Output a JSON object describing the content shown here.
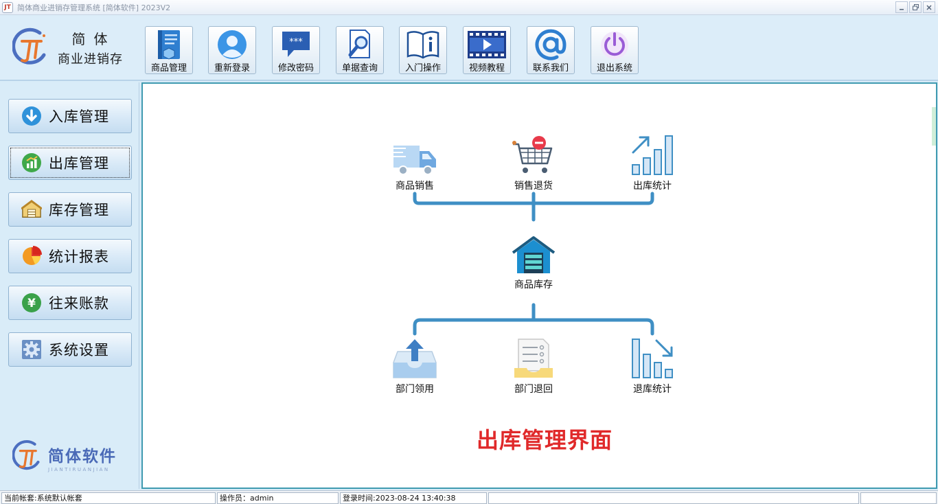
{
  "window": {
    "title": "简体商业进销存管理系统 [简体软件] 2023V2",
    "app_icon_glyph": "JT"
  },
  "header": {
    "logo_line1": "简体",
    "logo_line2": "商业进销存",
    "toolbar": [
      {
        "label": "商品管理",
        "icon": "goods-management-icon"
      },
      {
        "label": "重新登录",
        "icon": "user-relogin-icon"
      },
      {
        "label": "修改密码",
        "icon": "password-chat-icon"
      },
      {
        "label": "单据查询",
        "icon": "document-search-icon"
      },
      {
        "label": "入门操作",
        "icon": "book-info-icon"
      },
      {
        "label": "视频教程",
        "icon": "video-play-icon"
      },
      {
        "label": "联系我们",
        "icon": "at-sign-icon"
      },
      {
        "label": "退出系统",
        "icon": "power-icon"
      }
    ],
    "password_icon_text": "***"
  },
  "sidebar": {
    "items": [
      {
        "label": "入库管理",
        "icon": "arrow-down-icon"
      },
      {
        "label": "出库管理",
        "icon": "chart-up-icon"
      },
      {
        "label": "库存管理",
        "icon": "warehouse-icon"
      },
      {
        "label": "统计报表",
        "icon": "pie-chart-icon"
      },
      {
        "label": "往来账款",
        "icon": "yuan-icon"
      },
      {
        "label": "系统设置",
        "icon": "gear-icon"
      }
    ],
    "active_index": 1,
    "brand_name": "简体软件",
    "brand_pinyin": "JIANTIRUANJIAN",
    "yuan_glyph": "¥"
  },
  "main": {
    "top_nodes": [
      {
        "label": "商品销售",
        "icon": "delivery-truck-icon"
      },
      {
        "label": "销售退货",
        "icon": "cart-return-icon"
      },
      {
        "label": "出库统计",
        "icon": "bar-chart-up-icon"
      }
    ],
    "center_node": {
      "label": "商品库存",
      "icon": "warehouse-house-icon"
    },
    "bottom_nodes": [
      {
        "label": "部门领用",
        "icon": "tray-upload-icon"
      },
      {
        "label": "部门退回",
        "icon": "checklist-icon"
      },
      {
        "label": "退库统计",
        "icon": "bar-chart-down-icon"
      }
    ],
    "title": "出库管理界面",
    "title_color": "#e0292a",
    "connector_color": "#3f8fc4"
  },
  "status": {
    "account": "当前帐套:系统默认帐套",
    "operator": "操作员：admin",
    "login_time": "登录时间:2023-08-24 13:40:38"
  }
}
